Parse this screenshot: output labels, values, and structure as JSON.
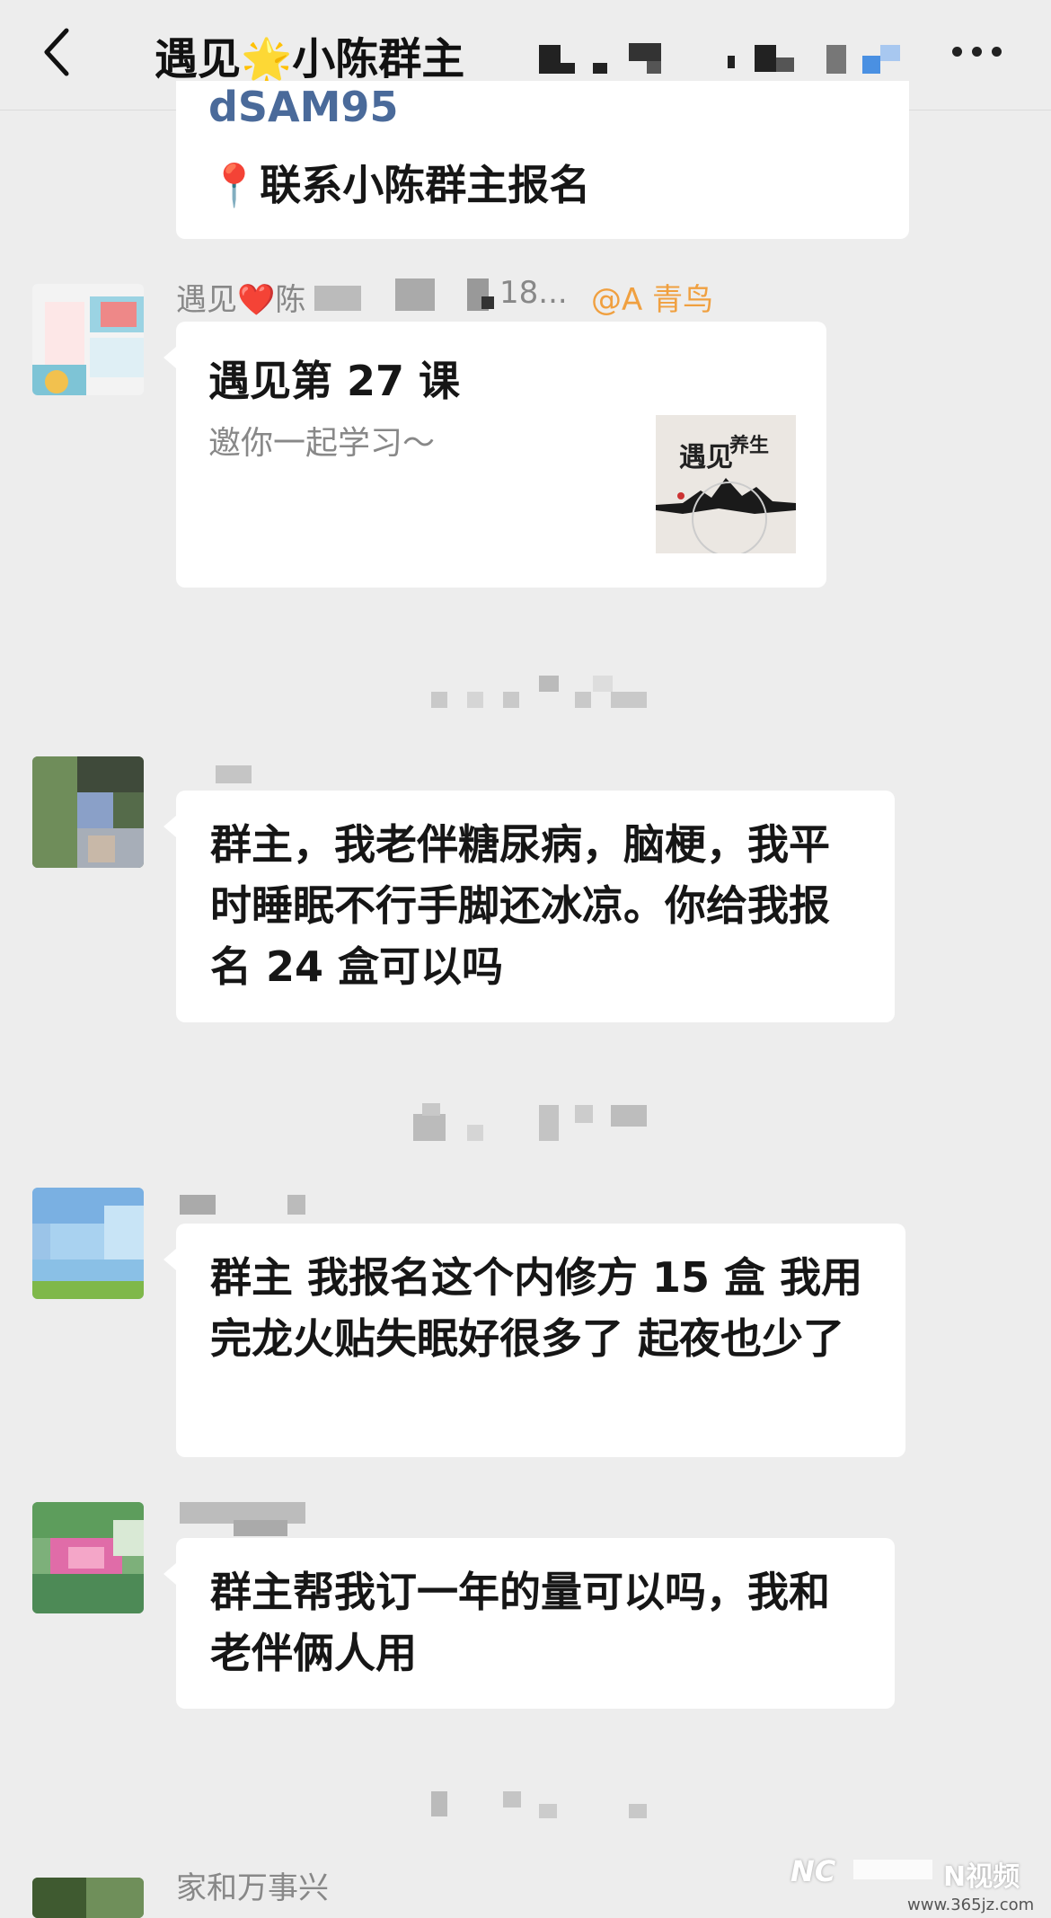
{
  "header": {
    "back_icon": "chevron-left-icon",
    "title_prefix": "遇见",
    "title_star": "🌟",
    "title_main": "小陈群主",
    "more_icon": "more-dots-icon"
  },
  "messages": [
    {
      "partial_link": "dSAM95",
      "pin_icon": "📍",
      "text": "联系小陈群主报名"
    },
    {
      "sender_prefix": "遇见",
      "sender_heart": "❤️",
      "sender_name": "陈",
      "sender_suffix": "18...",
      "mention": "@A 青鸟",
      "card_title": "遇见第 27 课",
      "card_subtitle": "邀你一起学习～",
      "thumb_text_1": "遇见",
      "thumb_text_2": "养生"
    },
    {
      "text": "群主，我老伴糖尿病，脑梗，我平时睡眠不行手脚还冰凉。你给我报名 24 盒可以吗"
    },
    {
      "text": "群主 我报名这个内修方 15 盒 我用完龙火贴失眠好很多了 起夜也少了"
    },
    {
      "text": "群主帮我订一年的量可以吗，我和老伴俩人用"
    },
    {
      "sender_name": "家和万事兴"
    }
  ],
  "watermark": {
    "brand_left": "NC",
    "brand_right": "N视频",
    "site": "www.365jz.com"
  }
}
